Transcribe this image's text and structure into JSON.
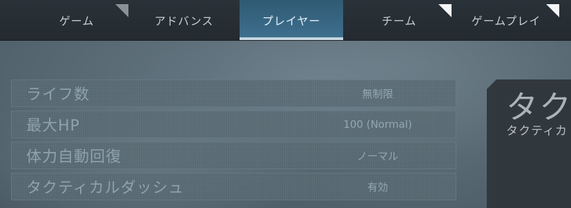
{
  "tabs": [
    {
      "label": "ゲーム",
      "active": false,
      "corner": "grey"
    },
    {
      "label": "アドバンス",
      "active": false,
      "corner": ""
    },
    {
      "label": "プレイヤー",
      "active": true,
      "corner": ""
    },
    {
      "label": "チーム",
      "active": false,
      "corner": "white"
    },
    {
      "label": "ゲームプレイ",
      "active": false,
      "corner": "white"
    }
  ],
  "settings": [
    {
      "label": "ライフ数",
      "value": "無制限"
    },
    {
      "label": "最大HP",
      "value": "100 (Normal)"
    },
    {
      "label": "体力自動回復",
      "value": "ノーマル"
    },
    {
      "label": "タクティカルダッシュ",
      "value": "有効"
    }
  ],
  "detail_panel": {
    "title": "タク",
    "subtitle": "タクティカ"
  },
  "colors": {
    "active_tab": "#3a6a88",
    "tab_bar": "#272e34",
    "row_text": "#8fa2ad",
    "panel": "#31383d"
  }
}
